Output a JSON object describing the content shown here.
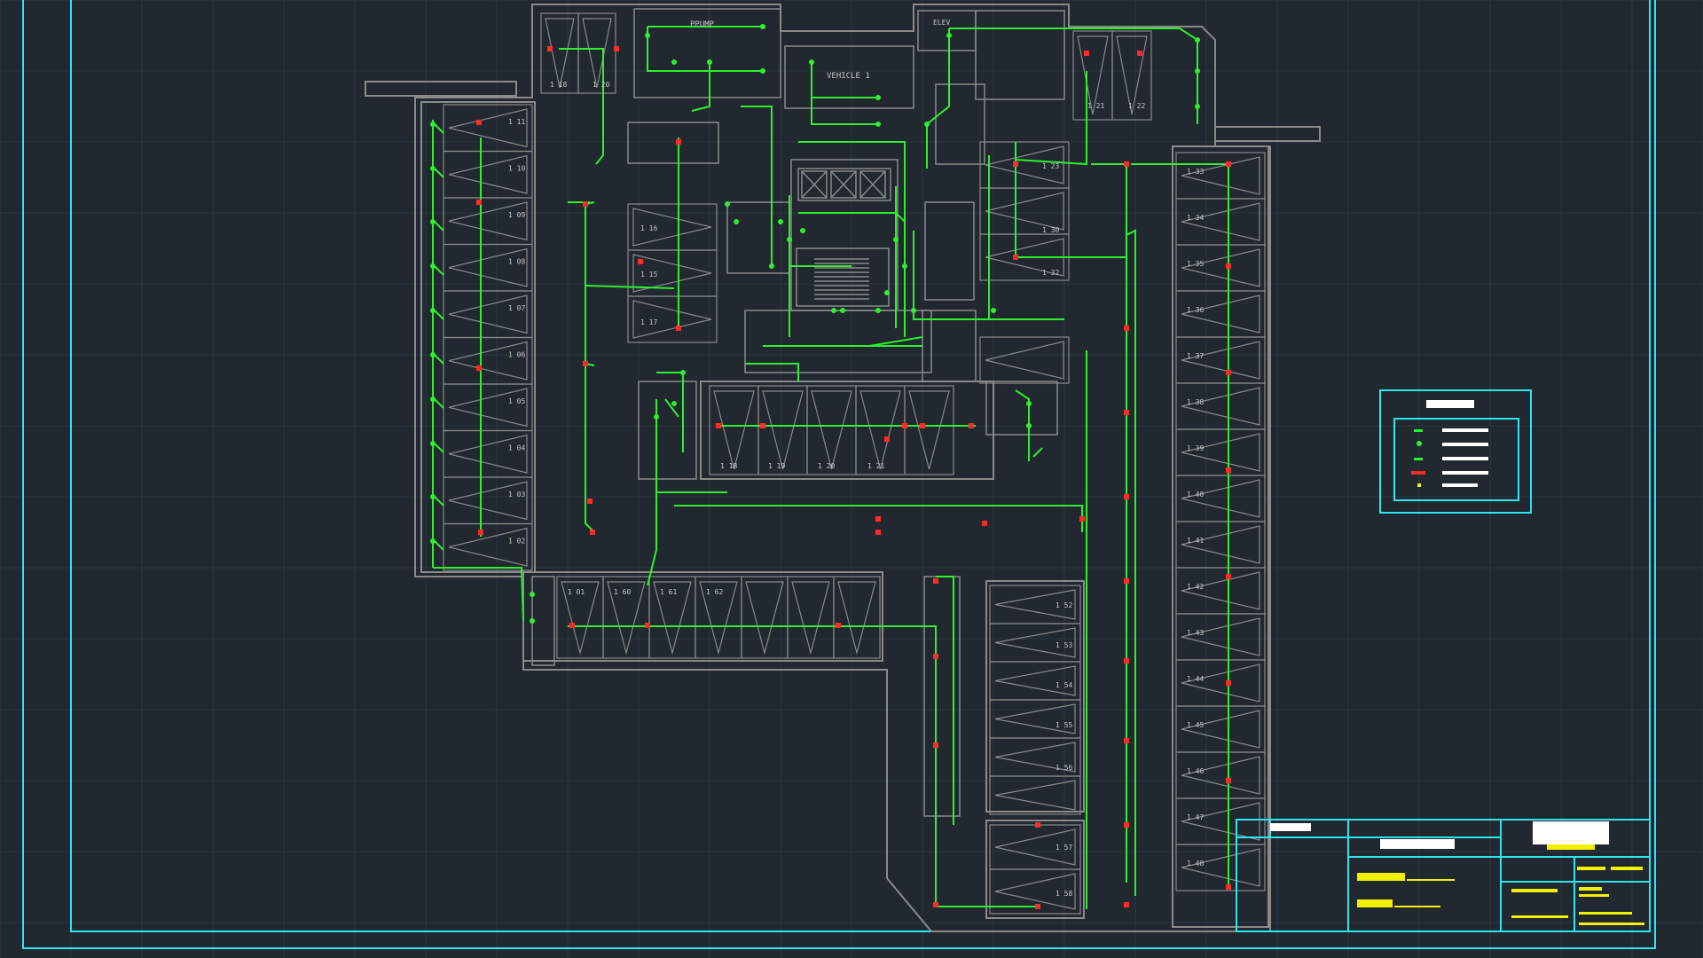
{
  "drawing": {
    "background": "#212830",
    "grid_color": "#2c3642",
    "frame_color": "#2ee6f0",
    "wall_color": "#8a8a8a",
    "circuit_color": "#2ef02e",
    "device_color": "#ff2a2a",
    "highlight_color": "#f0f000"
  },
  "room_labels": {
    "pump": "PPUMP",
    "vehicle": "VEHICLE 1",
    "elevator": "ELEV"
  },
  "stall_numbers": {
    "top_left": [
      "1 18",
      "1 20"
    ],
    "top_right": [
      "1 21",
      "1 22"
    ],
    "left_column": [
      "1 11",
      "1 10",
      "1 09",
      "1 08",
      "1 07",
      "1 06",
      "1 05",
      "1 04",
      "1 03",
      "1 02"
    ],
    "center_column": [
      "1 16",
      "1 15",
      "1 17"
    ],
    "center_right": [
      "1 23",
      "1 30",
      "1 32"
    ],
    "right_column": [
      "1 33",
      "1 34",
      "1 35",
      "1 36",
      "1 37",
      "1 38",
      "1 39",
      "1 40",
      "1 41",
      "1 42",
      "1 43",
      "1 44",
      "1 45",
      "1 46",
      "1 47",
      "1 48"
    ],
    "middle_row": [
      "1 18",
      "1 19",
      "1 20",
      "1 21"
    ],
    "bottom_row": [
      "1 01",
      "1 60",
      "1 61",
      "1 62"
    ],
    "bottom_right": [
      "1 52",
      "1 53",
      "1 54",
      "1 55",
      "1 56",
      "1 57",
      "1 58"
    ]
  }
}
